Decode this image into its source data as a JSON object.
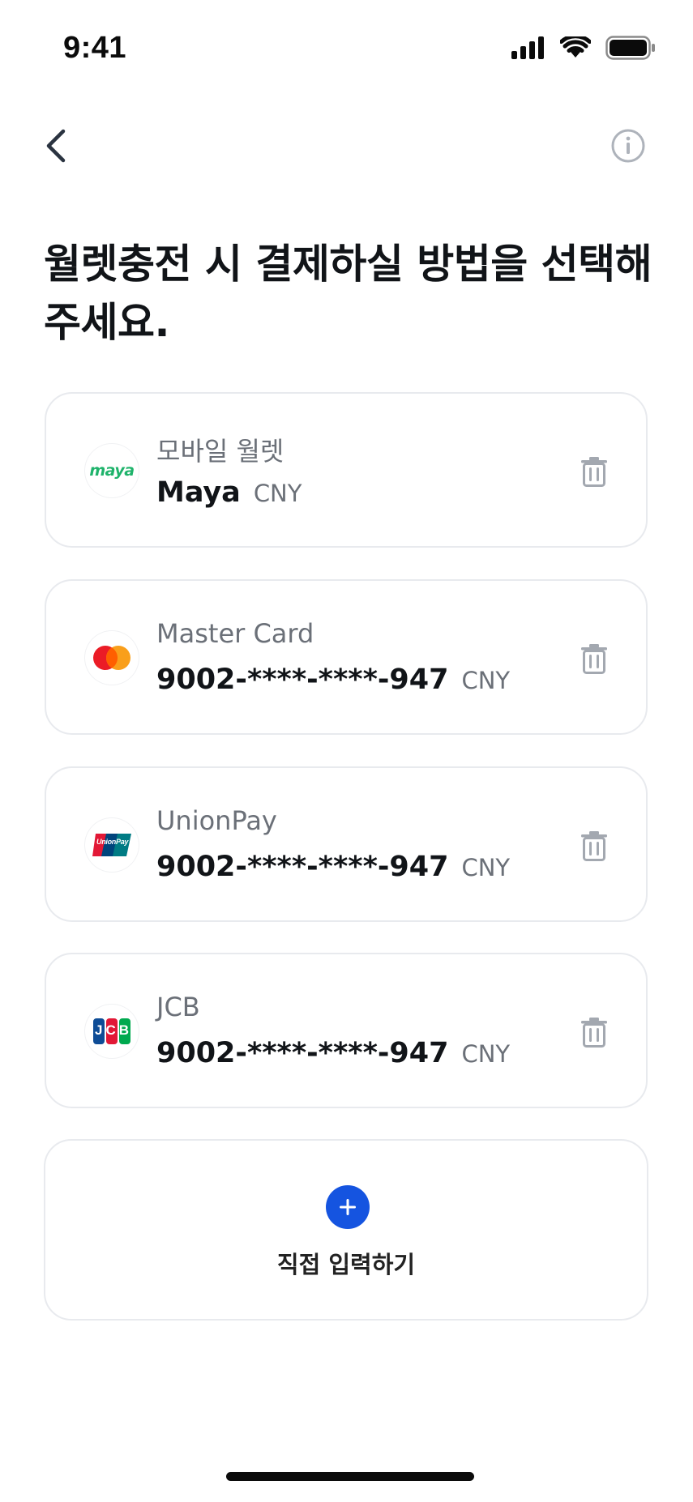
{
  "status_bar": {
    "time": "9:41"
  },
  "header": {
    "title": "월렛충전 시 결제하실 방법을 선택해 주세요."
  },
  "payment_methods": [
    {
      "type_label": "모바일 월렛",
      "number": "Maya",
      "currency": "CNY",
      "logo": "maya-logo"
    },
    {
      "type_label": "Master Card",
      "number": "9002-****-****-947",
      "currency": "CNY",
      "logo": "mastercard-logo"
    },
    {
      "type_label": "UnionPay",
      "number": "9002-****-****-947",
      "currency": "CNY",
      "logo": "unionpay-logo"
    },
    {
      "type_label": "JCB",
      "number": "9002-****-****-947",
      "currency": "CNY",
      "logo": "jcb-logo"
    }
  ],
  "logo_text": {
    "maya": "maya",
    "unionpay": "UnionPay",
    "jcb": "JCB"
  },
  "add_method": {
    "label": "직접 입력하기"
  },
  "colors": {
    "accent": "#1554e0",
    "border": "#e8eaee",
    "muted_text": "#6b7078",
    "maya_green": "#1fb36b"
  }
}
